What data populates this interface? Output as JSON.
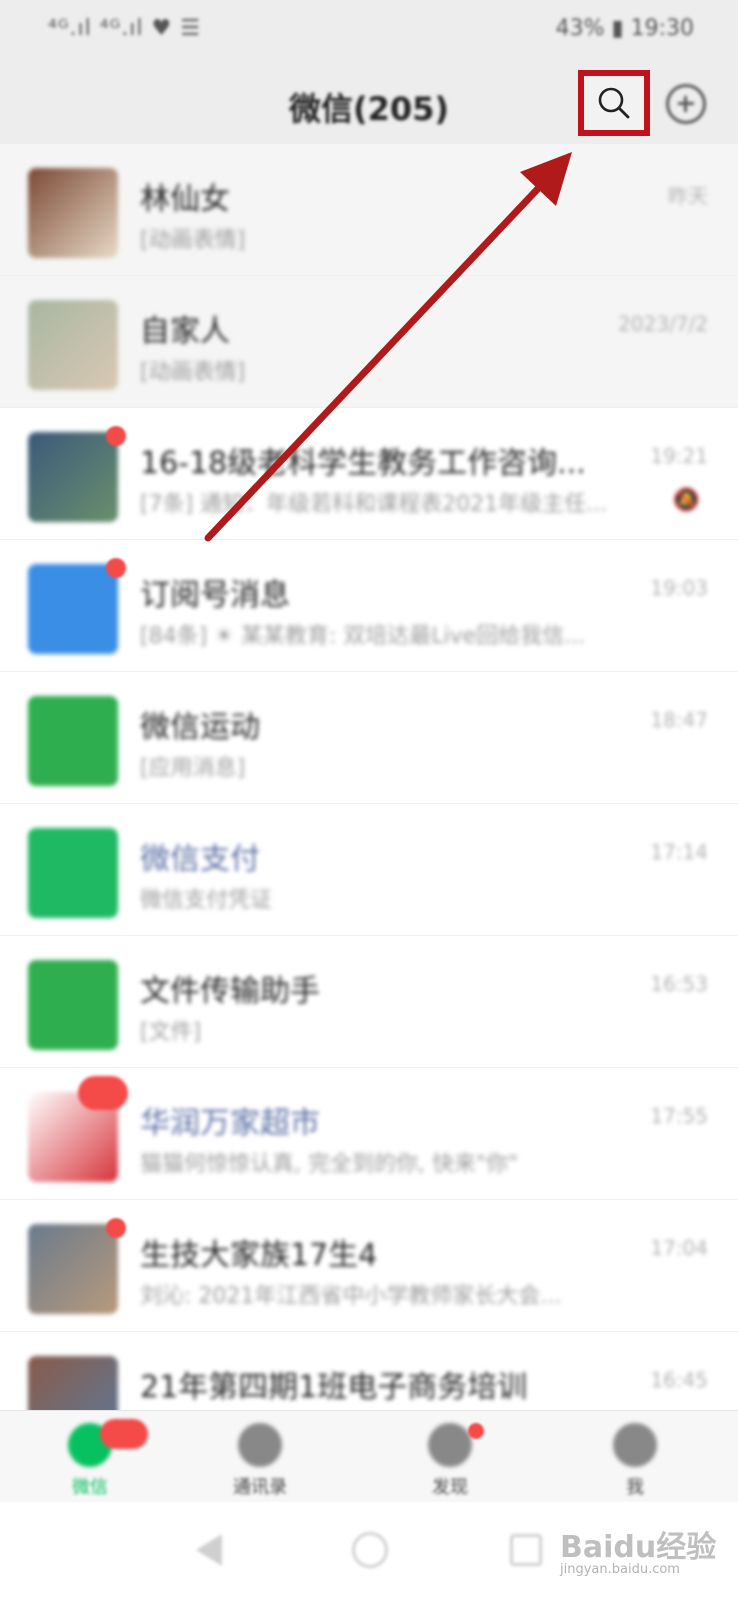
{
  "status_bar": {
    "left_text": "⁴ᴳ.ıl ⁴ᴳ.ıl ♥ ☰",
    "right_text": "43% ▮ 19:30"
  },
  "header": {
    "title": "微信(205)",
    "search_icon": "search-icon",
    "add_icon": "plus-circle-icon"
  },
  "chats": [
    {
      "name": "林仙女",
      "preview": "[动画表情]",
      "time": "昨天",
      "avatar_colors": [
        "#7a4a36",
        "#e8d9c6"
      ],
      "pinned": true,
      "badge": "none",
      "name_blue": false,
      "muted": false
    },
    {
      "name": "自家人",
      "preview": "[动画表情]",
      "time": "2023/7/2",
      "avatar_colors": [
        "#a8b7a2",
        "#d9c8b4"
      ],
      "pinned": true,
      "badge": "none",
      "name_blue": false,
      "muted": false
    },
    {
      "name": "16-18级老科学生教务工作咨询...",
      "preview": "[7条] 通知：年级若科和课程表2021年级主任...",
      "time": "19:21",
      "avatar_colors": [
        "#3a5a7a",
        "#6b8f6d"
      ],
      "pinned": false,
      "badge": "dot",
      "name_blue": false,
      "muted": true
    },
    {
      "name": "订阅号消息",
      "preview": "[84条] ☀ 某某教育: 双培达最Live回给我信...",
      "time": "19:03",
      "avatar_colors": [
        "#3a8ee6",
        "#3a8ee6"
      ],
      "pinned": false,
      "badge": "dot",
      "name_blue": false,
      "muted": false
    },
    {
      "name": "微信运动",
      "preview": "[应用消息]",
      "time": "18:47",
      "avatar_colors": [
        "#2fae4f",
        "#2fae4f"
      ],
      "pinned": false,
      "badge": "none",
      "name_blue": false,
      "muted": false
    },
    {
      "name": "微信支付",
      "preview": "微信支付凭证",
      "time": "17:14",
      "avatar_colors": [
        "#1fb863",
        "#1fb863"
      ],
      "pinned": false,
      "badge": "none",
      "name_blue": true,
      "muted": false
    },
    {
      "name": "文件传输助手",
      "preview": "[文件]",
      "time": "16:53",
      "avatar_colors": [
        "#2fae4f",
        "#2fae4f"
      ],
      "pinned": false,
      "badge": "none",
      "name_blue": false,
      "muted": false
    },
    {
      "name": "华润万家超市",
      "preview": "猫猫何惊惊认真, 完全到的你, 快来\"你\"",
      "time": "17:55",
      "avatar_colors": [
        "#ffffff",
        "#d6343b"
      ],
      "pinned": false,
      "badge": "pill",
      "name_blue": true,
      "muted": false
    },
    {
      "name": "生技大家族17生4",
      "preview": "刘沁: 2021年江西省中小学教师家长大会...",
      "time": "17:04",
      "avatar_colors": [
        "#6a7b8c",
        "#b89a7c"
      ],
      "pinned": false,
      "badge": "dot",
      "name_blue": false,
      "muted": false
    },
    {
      "name": "21年第四期1班电子商务培训",
      "preview": "",
      "time": "16:45",
      "avatar_colors": [
        "#8a5b4a",
        "#5a7a9a"
      ],
      "pinned": false,
      "badge": "none",
      "name_blue": false,
      "muted": false
    }
  ],
  "tabs": [
    {
      "label": "微信",
      "icon": "chat-bubbles-icon",
      "active": true,
      "badge": "pill"
    },
    {
      "label": "通讯录",
      "icon": "contacts-icon",
      "active": false,
      "badge": "none"
    },
    {
      "label": "发现",
      "icon": "compass-icon",
      "active": false,
      "badge": "dot"
    },
    {
      "label": "我",
      "icon": "person-icon",
      "active": false,
      "badge": "none"
    }
  ],
  "nav": {
    "back_icon": "back-triangle-icon",
    "home_icon": "home-circle-icon",
    "recent_icon": "recent-square-icon"
  },
  "watermark": {
    "text": "Baidu经验",
    "sub": "jingyan.baidu.com"
  },
  "annotation": {
    "highlight_color": "#c0121a",
    "arrow_color": "#b01a1a"
  }
}
